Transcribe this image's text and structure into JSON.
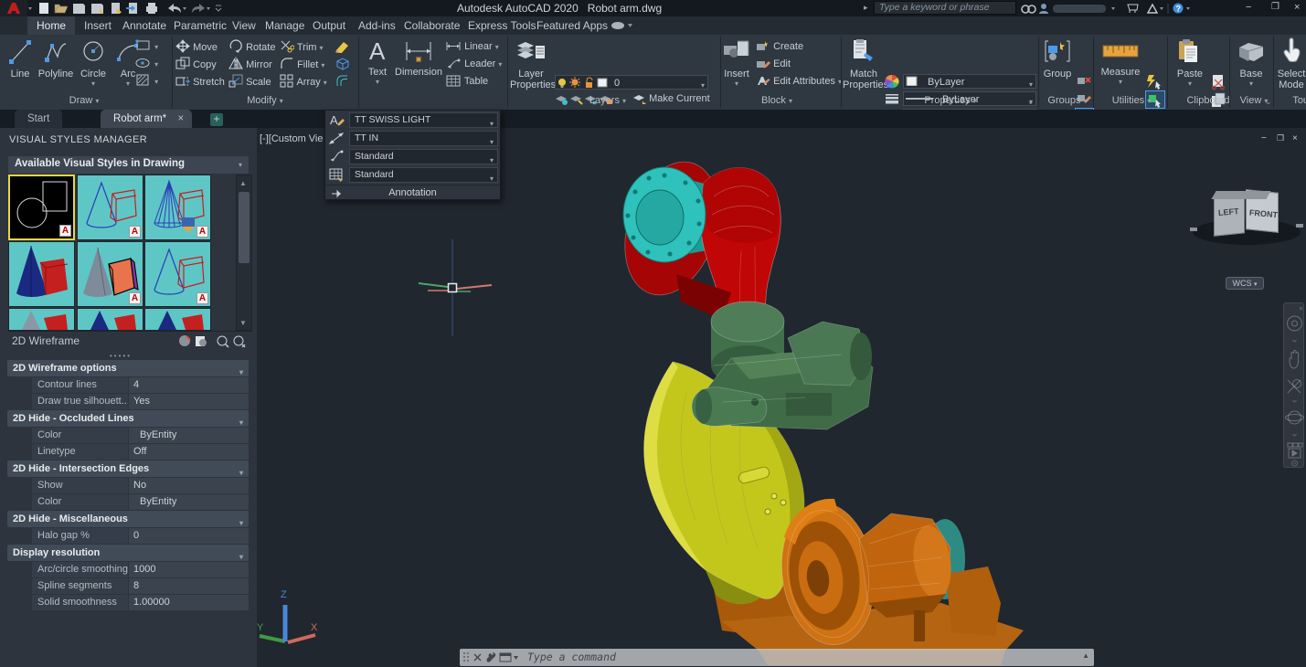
{
  "titlebar": {
    "title_app": "Autodesk AutoCAD 2020",
    "title_doc": "Robot arm.dwg",
    "search_placeholder": "Type a keyword or phrase"
  },
  "ribbon": {
    "tabs": [
      "Home",
      "Insert",
      "Annotate",
      "Parametric",
      "View",
      "Manage",
      "Output",
      "Add-ins",
      "Collaborate",
      "Express Tools",
      "Featured Apps"
    ],
    "draw": {
      "label": "Draw",
      "line": "Line",
      "polyline": "Polyline",
      "circle": "Circle",
      "arc": "Arc"
    },
    "modify": {
      "label": "Modify",
      "move": "Move",
      "rotate": "Rotate",
      "trim": "Trim",
      "copy": "Copy",
      "mirror": "Mirror",
      "fillet": "Fillet",
      "stretch": "Stretch",
      "scale": "Scale",
      "array": "Array"
    },
    "annotation": {
      "text": "Text",
      "dimension": "Dimension",
      "linear": "Linear",
      "leader": "Leader",
      "table": "Table"
    },
    "layers": {
      "label": "Layers",
      "big1": "Layer",
      "big2": "Properties",
      "combo_value": "0",
      "make_current": "Make Current",
      "match_layer": "Match Layer"
    },
    "block": {
      "label": "Block",
      "insert": "Insert",
      "create": "Create",
      "edit": "Edit",
      "edit_attributes": "Edit Attributes"
    },
    "properties": {
      "label": "Properties",
      "big1": "Match",
      "big2": "Properties",
      "color": "ByLayer",
      "lineweight": "ByLayer",
      "linetype": "ByLayer"
    },
    "groups": {
      "label": "Groups",
      "group": "Group"
    },
    "utilities": {
      "label": "Utilities",
      "measure": "Measure"
    },
    "clipboard": {
      "label": "Clipboard",
      "paste": "Paste"
    },
    "view": {
      "label": "View",
      "base": "Base"
    },
    "touch": {
      "label": "Touch",
      "line1": "Select",
      "line2": "Mode"
    }
  },
  "flyout": {
    "styles": [
      "TT SWISS LIGHT",
      "TT IN",
      "Standard",
      "Standard"
    ],
    "label": "Annotation"
  },
  "file_tabs": {
    "start": "Start",
    "doc": "Robot arm*"
  },
  "palette": {
    "title": "VISUAL STYLES MANAGER",
    "combo": "Available Visual Styles in Drawing",
    "selected_style_name": "2D Wireframe",
    "sections": [
      {
        "title": "2D Wireframe options",
        "rows": [
          {
            "label": "Contour lines",
            "value": "4"
          },
          {
            "label": "Draw  true  silhouett...",
            "value": "Yes"
          }
        ]
      },
      {
        "title": "2D Hide - Occluded Lines",
        "rows": [
          {
            "label": "Color",
            "value": "ByEntity"
          },
          {
            "label": "Linetype",
            "value": "Off"
          }
        ]
      },
      {
        "title": "2D Hide - Intersection Edges",
        "rows": [
          {
            "label": "Show",
            "value": "No"
          },
          {
            "label": "Color",
            "value": "ByEntity"
          }
        ]
      },
      {
        "title": "2D Hide - Miscellaneous",
        "rows": [
          {
            "label": "Halo gap %",
            "value": "0"
          }
        ]
      },
      {
        "title": "Display resolution",
        "rows": [
          {
            "label": "Arc/circle smoothing",
            "value": "1000"
          },
          {
            "label": "Spline segments",
            "value": "8"
          },
          {
            "label": "Solid smoothness",
            "value": "1.00000"
          }
        ]
      }
    ]
  },
  "viewport": {
    "label": "[-][Custom Vie",
    "viewcube_left": "LEFT",
    "viewcube_front": "FRONT",
    "wcs": "WCS"
  },
  "command": {
    "placeholder": "Type a command"
  },
  "robot": {
    "red": "#c00606",
    "teal": "#2fc1bb",
    "green": "#41704b",
    "yellow": "#c3c71b",
    "orange": "#c66b10"
  }
}
